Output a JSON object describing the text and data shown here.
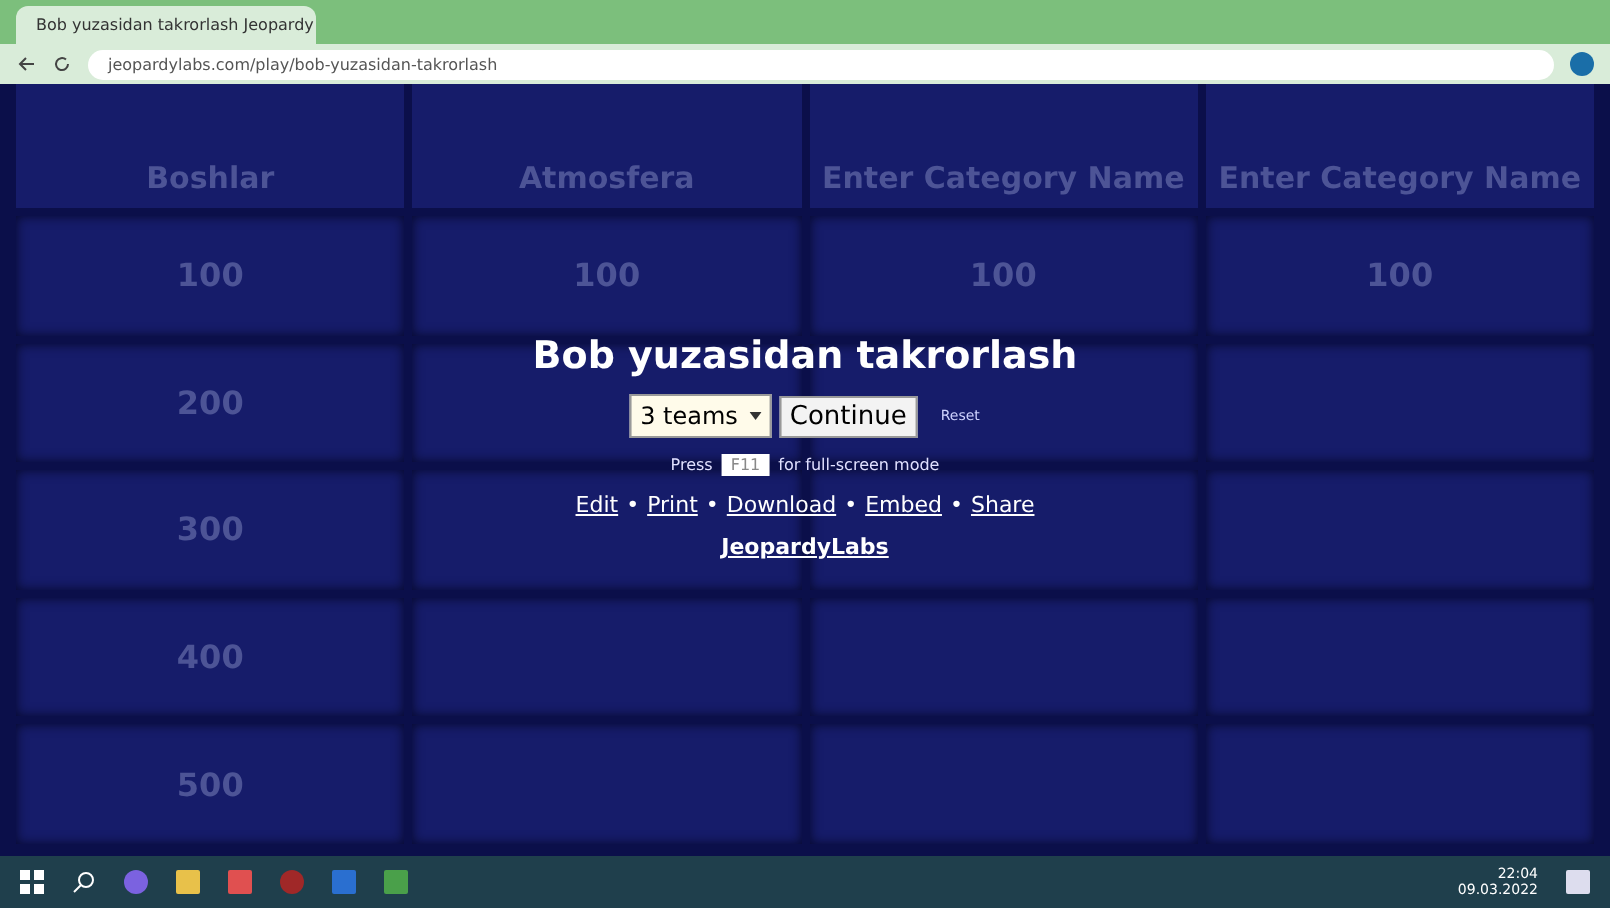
{
  "browser": {
    "tab_title": "Bob yuzasidan takrorlash Jeopardy",
    "url": "jeopardylabs.com/play/bob-yuzasidan-takrorlash"
  },
  "board": {
    "categories": [
      "Boshlar",
      "Atmosfera",
      "Enter Category Name",
      "Enter Category Name"
    ],
    "rows": [
      {
        "cells": [
          {
            "value": "100"
          },
          {
            "value": "100"
          },
          {
            "value": "100"
          },
          {
            "value": "100"
          }
        ]
      },
      {
        "cells": [
          {
            "value": "200"
          },
          {},
          {},
          {}
        ]
      },
      {
        "cells": [
          {
            "value": "300"
          },
          {},
          {},
          {}
        ]
      },
      {
        "cells": [
          {
            "value": "400"
          },
          {},
          {},
          {}
        ]
      },
      {
        "cells": [
          {
            "value": "500"
          },
          {},
          {},
          {}
        ]
      }
    ]
  },
  "overlay": {
    "title": "Bob yuzasidan takrorlash",
    "team_select": "3 teams",
    "continue_button": "Continue",
    "reset_link": "Reset",
    "press_before": "Press",
    "key": "F11",
    "press_after": "for full-screen mode",
    "links": [
      "Edit",
      "Print",
      "Download",
      "Embed",
      "Share"
    ],
    "separator": "•",
    "brand_link": "JeopardyLabs"
  },
  "taskbar": {
    "time": "22:04",
    "date": "09.03.2022"
  }
}
